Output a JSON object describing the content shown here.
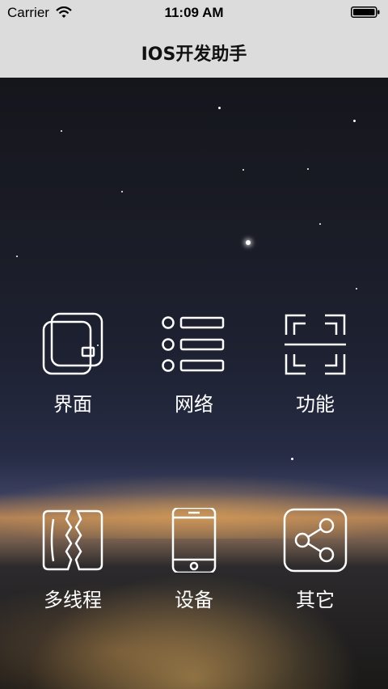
{
  "status_bar": {
    "carrier": "Carrier",
    "time": "11:09 AM"
  },
  "nav": {
    "title": "IOS开发助手"
  },
  "grid": {
    "items": [
      {
        "label": "界面",
        "icon": "wallet-icon"
      },
      {
        "label": "网络",
        "icon": "list-icon"
      },
      {
        "label": "功能",
        "icon": "scan-icon"
      },
      {
        "label": "多线程",
        "icon": "thread-icon"
      },
      {
        "label": "设备",
        "icon": "device-icon"
      },
      {
        "label": "其它",
        "icon": "share-icon"
      }
    ]
  },
  "colors": {
    "nav_background": "#dcdcdc",
    "icon_stroke": "#ffffff",
    "label_text": "#ffffff"
  }
}
